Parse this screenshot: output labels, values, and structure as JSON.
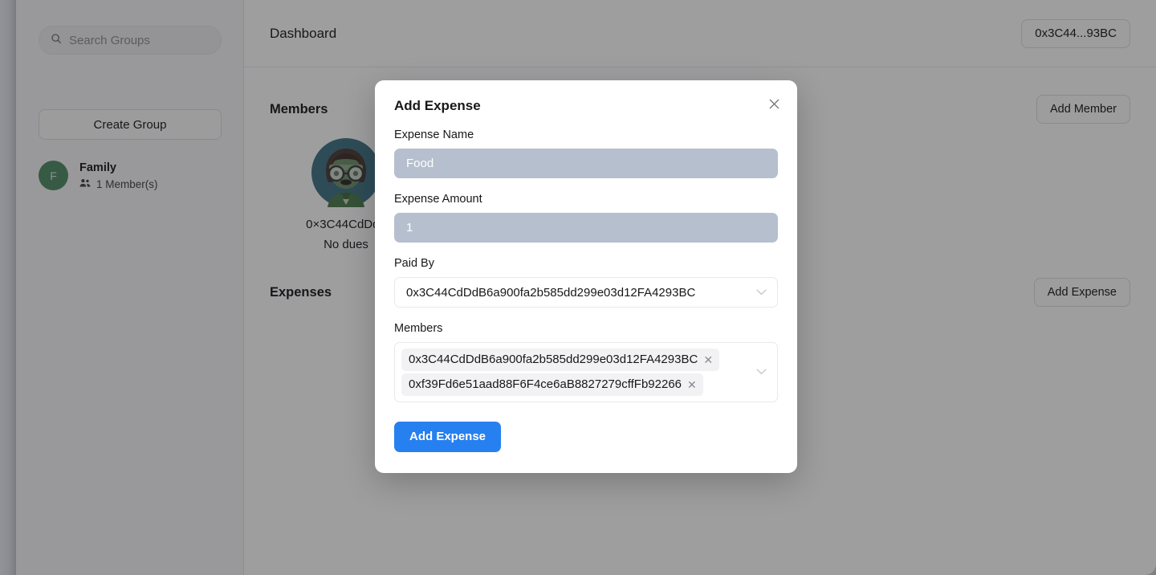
{
  "sidebar": {
    "search": {
      "placeholder": "Search Groups",
      "value": "",
      "icon": "search-icon"
    },
    "create_group_label": "Create Group",
    "groups": [
      {
        "avatar_initial": "F",
        "avatar_color": "#4e8a64",
        "name": "Family",
        "members_count_label": "1 Member(s)",
        "members_icon": "people-icon"
      }
    ]
  },
  "header": {
    "title": "Dashboard",
    "wallet_button_label": "0x3C44...93BC"
  },
  "main": {
    "members_section": {
      "title": "Members",
      "action_label": "Add Member",
      "members": [
        {
          "avatar": "pixel-avatar",
          "name": "0×3C44CdDd..",
          "dues": "No dues"
        }
      ]
    },
    "expenses_section": {
      "title": "Expenses",
      "action_label": "Add Expense",
      "expenses": []
    }
  },
  "modal": {
    "title": "Add Expense",
    "close_icon": "close-icon",
    "fields": {
      "expense_name": {
        "label": "Expense Name",
        "value": "Food",
        "state": "selected"
      },
      "expense_amount": {
        "label": "Expense Amount",
        "value": "1",
        "state": "selected"
      },
      "paid_by": {
        "label": "Paid By",
        "value": "0x3C44CdDdB6a900fa2b585dd299e03d12FA4293BC",
        "chevron_icon": "chevron-down-icon"
      },
      "members": {
        "label": "Members",
        "chevron_icon": "chevron-down-icon",
        "chips": [
          {
            "label": "0x3C44CdDdB6a900fa2b585dd299e03d12FA4293BC",
            "remove_icon": "close-small-icon"
          },
          {
            "label": "0xf39Fd6e51aad88F6F4ce6aB8827279cffFb92266",
            "remove_icon": "close-small-icon"
          }
        ]
      }
    },
    "submit_label": "Add Expense",
    "accent_color": "#2680f0"
  }
}
